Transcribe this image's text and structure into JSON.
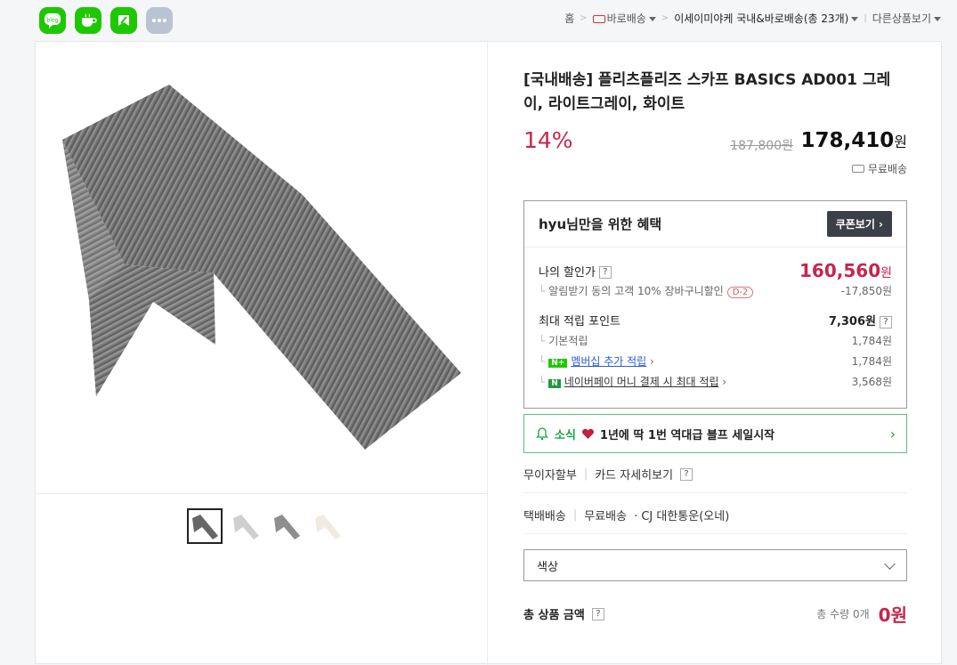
{
  "share": {
    "blog_label": "blog"
  },
  "breadcrumb": {
    "home": "홈",
    "delivery": "바로배송",
    "category": "이세이미야케 국내&바로배송(총 23개)",
    "other": "다른상품보기"
  },
  "product": {
    "title": "[국내배송] 플리츠플리즈 스카프 BASICS AD001 그레이, 라이트그레이, 화이트",
    "discount_rate": "14%",
    "original_price": "187,800원",
    "price_num": "178,410",
    "price_unit": "원",
    "shipping": "무료배송"
  },
  "benefit": {
    "heading": "hyu님만을 위한 혜택",
    "coupon_button": "쿠폰보기",
    "my_price_label": "나의 할인가",
    "my_price_num": "160,560",
    "my_price_unit": "원",
    "alert_label": "알림받기 동의 고객 10% 장바구니할인",
    "alert_badge": "D-2",
    "alert_amount": "-17,850원",
    "points_label": "최대 적립 포인트",
    "points_total": "7,306원",
    "base_label": "기본적립",
    "base_value": "1,784원",
    "member_label": "멤버십 추가 적립",
    "member_value": "1,784원",
    "pay_label": "네이버페이 머니 결제 시 최대 적립",
    "pay_value": "3,568원"
  },
  "notice": {
    "label": "소식",
    "text": "1년에 딱 1번 역대급 블프 세일시작"
  },
  "payment": {
    "installment": "무이자할부",
    "card_detail": "카드 자세히보기"
  },
  "delivery": {
    "type": "택배배송",
    "fee": "무료배송",
    "carrier": "· CJ 대한통운(오네)"
  },
  "option": {
    "placeholder": "색상"
  },
  "total": {
    "label": "총 상품 금액",
    "qty": "총 수량 0개",
    "amount": "0원"
  },
  "thumbnails": [
    "gray",
    "lightgray",
    "gray-2",
    "white"
  ]
}
